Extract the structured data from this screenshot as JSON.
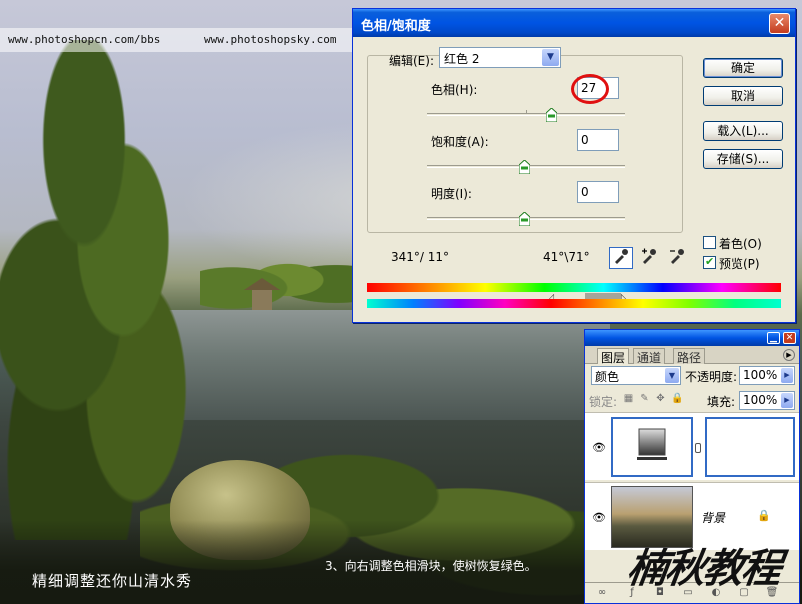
{
  "watermark": {
    "url_left": "www.photoshopcn.com/bbs",
    "url_right": "www.photoshopsky.com"
  },
  "captions": {
    "bottom_left": "精细调整还你山清水秀",
    "instruction": "3、向右调整色相滑块，使树恢复绿色。",
    "signature": "楠秋教程"
  },
  "dialog": {
    "title": "色相/饱和度",
    "close_glyph": "✕",
    "edit_label": "编辑(E):",
    "edit_value": "红色 2",
    "hue_label": "色相(H):",
    "hue_value": "27",
    "saturation_label": "饱和度(A):",
    "saturation_value": "0",
    "lightness_label": "明度(I):",
    "lightness_value": "0",
    "readout_left": "341°/ 11°",
    "readout_right": "41°\\71°",
    "buttons": {
      "ok": "确定",
      "cancel": "取消",
      "load": "载入(L)...",
      "save": "存储(S)..."
    },
    "colorize": {
      "label": "着色(O)",
      "checked": false
    },
    "preview": {
      "label": "预览(P)",
      "checked": true
    },
    "droppers": [
      "eyedropper-icon",
      "eyedropper-plus-icon",
      "eyedropper-minus-icon"
    ]
  },
  "layers_panel": {
    "tabs": [
      "图层",
      "通道",
      "路径"
    ],
    "active_tab": "图层",
    "blend_mode": "颜色",
    "opacity_label": "不透明度:",
    "opacity_value": "100%",
    "lock_label": "锁定:",
    "fill_label": "填充:",
    "fill_value": "100%",
    "layers": [
      {
        "name": "",
        "type": "adjustment-hue-saturation",
        "visible": true,
        "selected": true
      },
      {
        "name": "背景",
        "type": "background",
        "visible": true,
        "locked": true
      }
    ],
    "colors": {
      "selected": "#316ac5"
    }
  },
  "colors": {
    "titlebar": "#0054e3",
    "dialog_bg": "#ece9d8",
    "highlight_circle": "#e01010"
  }
}
